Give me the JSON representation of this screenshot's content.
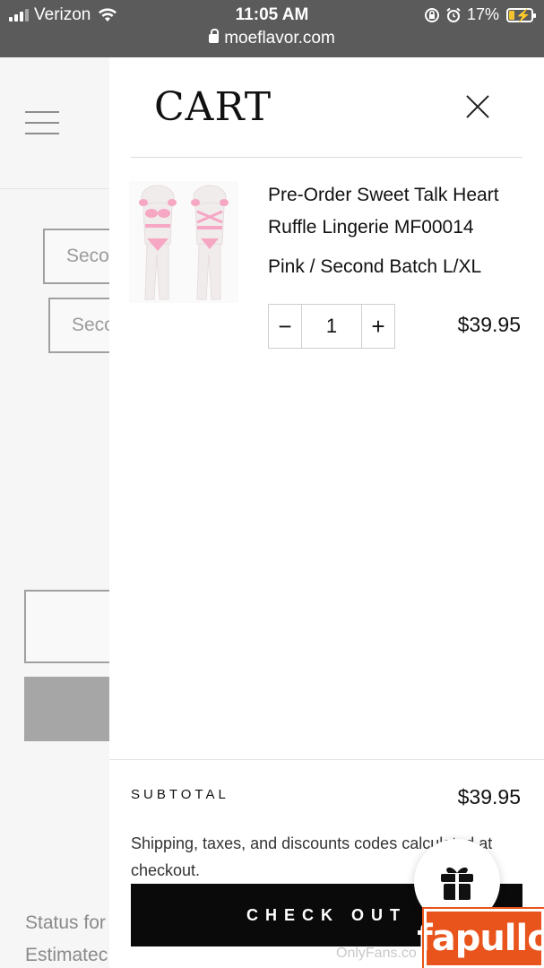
{
  "status_bar": {
    "carrier": "Verizon",
    "time": "11:05 AM",
    "battery_percent": "17%",
    "url": "moeflavor.com"
  },
  "background_page": {
    "field_1_text": "Seco",
    "field_2_text": "Seco",
    "text_line_1": "Status for",
    "text_line_2": "Estimatec"
  },
  "cart": {
    "title": "CART",
    "item": {
      "name": "Pre-Order Sweet Talk Heart Ruffle Lingerie MF00014",
      "variant": "Pink / Second Batch L/XL",
      "quantity": "1",
      "decrease_symbol": "−",
      "increase_symbol": "+",
      "price": "$39.95",
      "image_icon": "lingerie-product-photo"
    },
    "subtotal_label": "SUBTOTAL",
    "subtotal_value": "$39.95",
    "shipping_note": "Shipping, taxes, and discounts codes calculated at checkout.",
    "checkout_label": "CHECK OUT"
  },
  "overlays": {
    "gift_icon": "gift-icon",
    "watermark": "OnlyFans.co",
    "brand_badge": "fapullo"
  },
  "colors": {
    "status_bar_bg": "#5b5b5b",
    "checkout_bg": "#0a0a0a",
    "badge_orange": "#e8541c",
    "battery_yellow": "#f4c430"
  }
}
